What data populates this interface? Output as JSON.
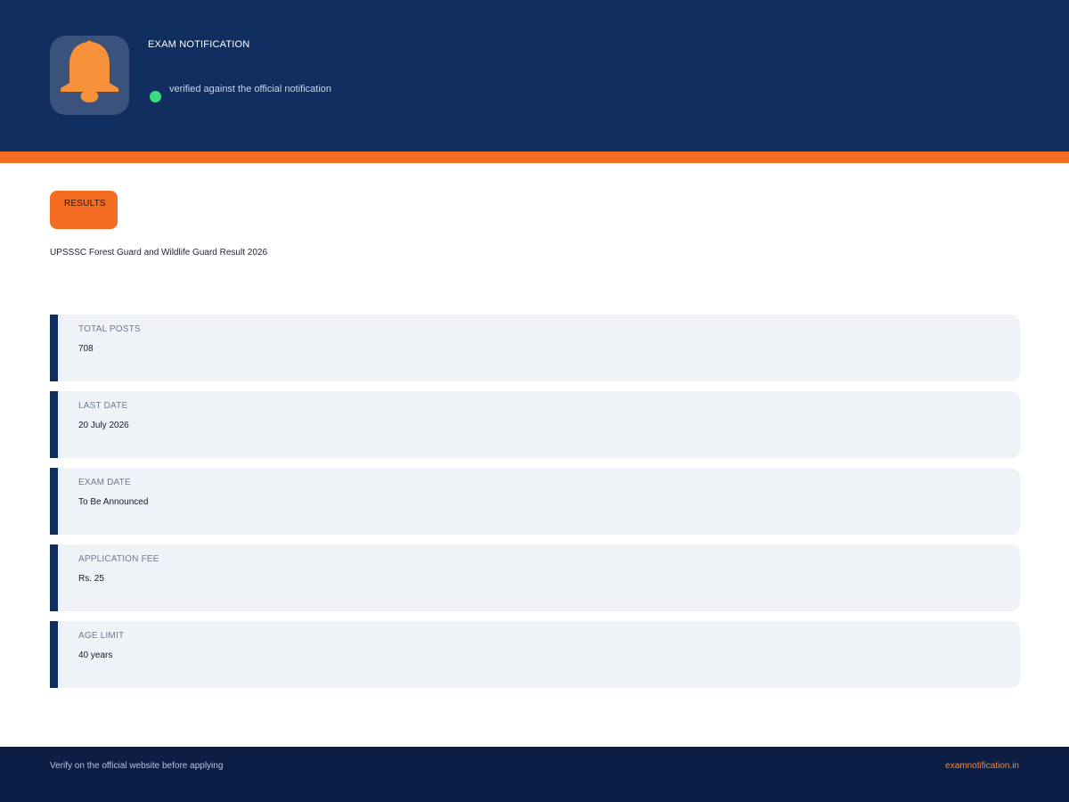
{
  "header": {
    "brand_title": "EXAM NOTIFICATION",
    "verified_text": "verified against the official notification",
    "logo_icon": "bell-icon"
  },
  "category": {
    "label": "RESULTS"
  },
  "page": {
    "title": "UPSSSC Forest Guard and Wildlife Guard Result 2026"
  },
  "cards": [
    {
      "label": "TOTAL POSTS",
      "value": "708"
    },
    {
      "label": "LAST DATE",
      "value": "20 July 2026"
    },
    {
      "label": "EXAM DATE",
      "value": "To Be Announced"
    },
    {
      "label": "APPLICATION FEE",
      "value": "Rs. 25"
    },
    {
      "label": "AGE LIMIT",
      "value": "40 years"
    }
  ],
  "footer": {
    "note": "Verify on the official website before applying",
    "link": "examnotification.in"
  },
  "colors": {
    "header_bg": "#112e60",
    "accent_orange": "#f36c21",
    "verified_green": "#3ddc84",
    "card_bg": "#eff3f8",
    "footer_bg": "#0c1e44"
  }
}
